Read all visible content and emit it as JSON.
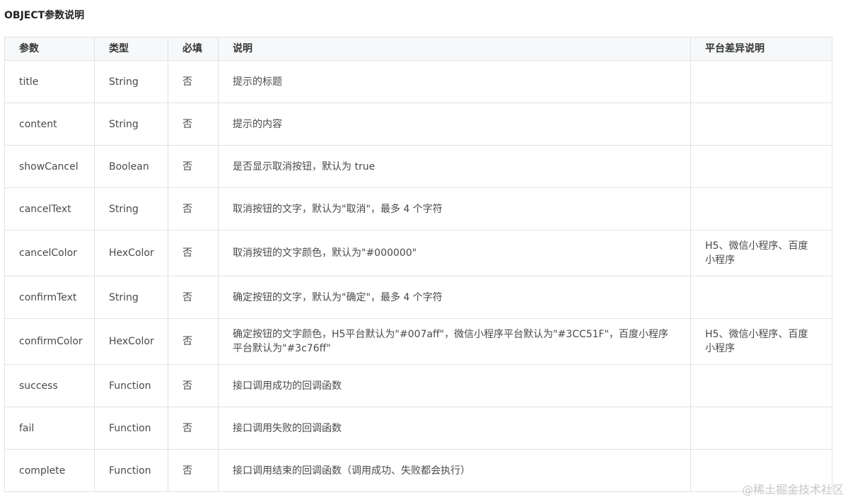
{
  "section_title": "OBJECT参数说明",
  "table": {
    "headers": [
      "参数",
      "类型",
      "必填",
      "说明",
      "平台差异说明"
    ],
    "rows": [
      {
        "param": "title",
        "type": "String",
        "required": "否",
        "desc": "提示的标题",
        "platform": ""
      },
      {
        "param": "content",
        "type": "String",
        "required": "否",
        "desc": "提示的内容",
        "platform": ""
      },
      {
        "param": "showCancel",
        "type": "Boolean",
        "required": "否",
        "desc": "是否显示取消按钮，默认为 true",
        "platform": ""
      },
      {
        "param": "cancelText",
        "type": "String",
        "required": "否",
        "desc": "取消按钮的文字，默认为\"取消\"，最多 4 个字符",
        "platform": ""
      },
      {
        "param": "cancelColor",
        "type": "HexColor",
        "required": "否",
        "desc": "取消按钮的文字颜色，默认为\"#000000\"",
        "platform": "H5、微信小程序、百度小程序"
      },
      {
        "param": "confirmText",
        "type": "String",
        "required": "否",
        "desc": "确定按钮的文字，默认为\"确定\"，最多 4 个字符",
        "platform": ""
      },
      {
        "param": "confirmColor",
        "type": "HexColor",
        "required": "否",
        "desc": "确定按钮的文字颜色，H5平台默认为\"#007aff\"，微信小程序平台默认为\"#3CC51F\"，百度小程序平台默认为\"#3c76ff\"",
        "platform": "H5、微信小程序、百度小程序"
      },
      {
        "param": "success",
        "type": "Function",
        "required": "否",
        "desc": "接口调用成功的回调函数",
        "platform": ""
      },
      {
        "param": "fail",
        "type": "Function",
        "required": "否",
        "desc": "接口调用失败的回调函数",
        "platform": ""
      },
      {
        "param": "complete",
        "type": "Function",
        "required": "否",
        "desc": "接口调用结束的回调函数（调用成功、失败都会执行）",
        "platform": ""
      }
    ]
  },
  "watermark": "@稀土掘金技术社区"
}
